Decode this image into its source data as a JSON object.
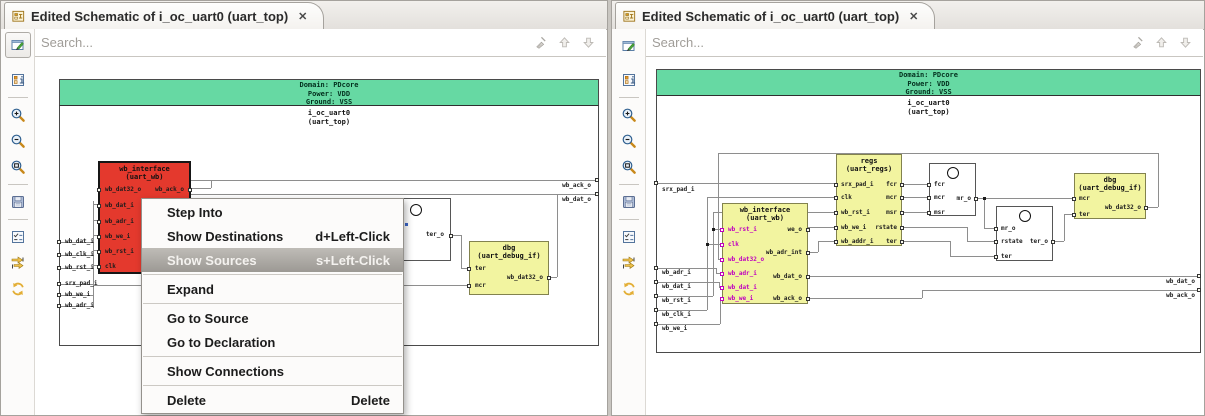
{
  "left_panel": {
    "tab": {
      "title": "Edited Schematic of i_oc_uart0 (uart_top)",
      "close_glyph": "✕"
    },
    "search": {
      "placeholder": "Search..."
    },
    "schematic": {
      "banner": [
        "Domain: PDcore",
        "Power: VDD",
        "Ground: VSS"
      ],
      "instance_name": "i_oc_uart0",
      "instance_type": "(uart_top)",
      "border_pins_left": [
        "wb_dat_i",
        "wb_clk_i",
        "wb_rst_i",
        "srx_pad_i",
        "wb_we_i",
        "wb_adr_i"
      ],
      "border_pins_right": [
        "wb_ack_o",
        "wb_dat_o"
      ],
      "wb_interface": {
        "name": "wb_interface",
        "type": "(uart_wb)",
        "pins_left": [
          "wb_dat32_o",
          "wb_dat_i",
          "wb_adr_i",
          "wb_we_i",
          "wb_rst_i",
          "clk"
        ],
        "pins_right": [
          "wb_ack_o"
        ]
      },
      "mux": {
        "pin_out": "ter_o"
      },
      "dbg": {
        "name": "dbg",
        "type": "(uart_debug_if)",
        "pins_left": [
          "ter",
          "mcr"
        ],
        "pins_right": [
          "wb_dat32_o"
        ]
      }
    },
    "context_menu": {
      "items": [
        {
          "label": "Step Into",
          "shortcut": ""
        },
        {
          "label": "Show Destinations",
          "shortcut": "d+Left-Click"
        },
        {
          "label": "Show Sources",
          "shortcut": "s+Left-Click"
        },
        {
          "label": "Expand",
          "shortcut": ""
        },
        {
          "label": "Go to Source",
          "shortcut": ""
        },
        {
          "label": "Go to Declaration",
          "shortcut": ""
        },
        {
          "label": "Show Connections",
          "shortcut": ""
        },
        {
          "label": "Delete",
          "shortcut": "Delete"
        }
      ]
    }
  },
  "right_panel": {
    "tab": {
      "title": "Edited Schematic of i_oc_uart0 (uart_top)",
      "close_glyph": "✕"
    },
    "search": {
      "placeholder": "Search..."
    },
    "schematic": {
      "banner": [
        "Domain: PDcore",
        "Power: VDD",
        "Ground: VSS"
      ],
      "instance_name": "i_oc_uart0",
      "instance_type": "(uart_top)",
      "border_pins_left": [
        "srx_pad_i",
        "wb_adr_i",
        "wb_dat_i",
        "wb_rst_i",
        "wb_clk_i",
        "wb_we_i"
      ],
      "border_pins_right": [
        "wb_dat_o",
        "wb_ack_o"
      ],
      "wb_interface": {
        "name": "wb_interface",
        "type": "(uart_wb)",
        "pins_left": [
          "wb_rst_i",
          "clk",
          "wb_dat32_o",
          "wb_adr_i",
          "wb_dat_i",
          "wb_we_i"
        ],
        "pins_right": [
          "we_o",
          "wb_adr_int",
          "wb_dat_o",
          "wb_ack_o"
        ]
      },
      "regs": {
        "name": "regs",
        "type": "(uart_regs)",
        "pins_left": [
          "srx_pad_i",
          "clk",
          "wb_rst_i",
          "wb_we_i",
          "wb_addr_i"
        ],
        "pins_right": [
          "fcr",
          "mcr",
          "msr",
          "rstate",
          "ter"
        ]
      },
      "mux_a": {
        "pins_left": [
          "fcr",
          "mcr",
          "msr"
        ],
        "pin_out": "mr_o"
      },
      "mux_b": {
        "pins_left": [
          "mr_o",
          "rstate",
          "ter"
        ],
        "pin_out": "ter_o"
      },
      "dbg": {
        "name": "dbg",
        "type": "(uart_debug_if)",
        "pins_left": [
          "mcr",
          "ter"
        ],
        "pins_right": [
          "wb_dat32_o"
        ]
      }
    }
  },
  "toolbar_icons": [
    "schematic-properties",
    "zoom-in",
    "zoom-out",
    "zoom-fit",
    "save",
    "filters",
    "trace-connections",
    "refresh"
  ],
  "colors": {
    "domain_banner_green": "#66D9A3",
    "block_yellow": "#F2F4A0",
    "selected_block_red": "#E4392D",
    "pin_highlight_magenta": "#BF00BF",
    "menu_highlight_gray": "#A9A6A1"
  }
}
